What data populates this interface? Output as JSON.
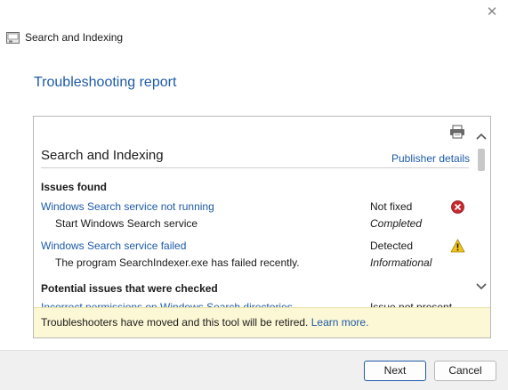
{
  "window": {
    "title": "Search and Indexing",
    "close_glyph": "✕",
    "icons": {
      "app": "troubleshooter-icon",
      "close": "close-icon"
    }
  },
  "page": {
    "title": "Troubleshooting report"
  },
  "report": {
    "section_title": "Search and Indexing",
    "publisher_link": "Publisher details",
    "issues_found_header": "Issues found",
    "issues": [
      {
        "title": "Windows Search service not running",
        "status": "Not fixed",
        "status_icon": "error-icon",
        "sub_step": "Start Windows Search service",
        "sub_status": "Completed"
      },
      {
        "title": "Windows Search service failed",
        "status": "Detected",
        "status_icon": "warning-icon",
        "sub_step": "The program SearchIndexer.exe has failed recently.",
        "sub_status": "Informational"
      }
    ],
    "potential_header": "Potential issues that were checked",
    "potential_issues": [
      {
        "title": "Incorrect permissions on Windows Search directories",
        "status": "Issue not present"
      }
    ]
  },
  "banner": {
    "text": "Troubleshooters have moved and this tool will be retired.",
    "link": "Learn more."
  },
  "footer": {
    "next_label": "Next",
    "cancel_label": "Cancel"
  },
  "colors": {
    "link": "#1e5aa8",
    "error": "#c8282d",
    "warning": "#f0c419",
    "banner": "#fcf7d4"
  }
}
